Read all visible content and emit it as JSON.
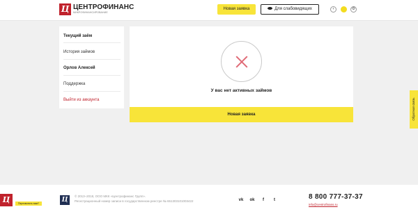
{
  "header": {
    "logo_mark": "Ц",
    "logo_name": "ЦЕНТРОФИНАНС",
    "logo_tagline": "МИКРОФИНАНСИРОВАНИЕ",
    "new_loan_label": "Новая заявка",
    "visually_impaired_label": "Для слабовидящих",
    "theme_prev_icon": "arrow-left-icon",
    "theme_sun_icon": "sun-icon",
    "settings_icon": "gear-icon"
  },
  "sidebar": {
    "items": [
      {
        "label": "Текущий заём",
        "state": "active"
      },
      {
        "label": "История займов",
        "state": "normal"
      },
      {
        "label": "Орлов Алексей",
        "state": "user"
      },
      {
        "label": "Поддержка",
        "state": "normal"
      },
      {
        "label": "Выйти из аккаунта",
        "state": "logout"
      }
    ]
  },
  "main": {
    "status_icon": "close-icon",
    "empty_message": "У вас нет активных займов",
    "new_loan_button": "Новая заявка"
  },
  "feedback_tab": {
    "label": "Обратная связь"
  },
  "footer": {
    "callback_label": "Перезвонить вам?",
    "copyright": "© 2013–2018, ООО МКК «Центрофинанс Групп».",
    "registration": "Регистрационный номер записи в государственном реестре № 651303101003422",
    "social_icons": [
      "vk-icon",
      "ok-icon",
      "facebook-icon",
      "twitter-icon"
    ],
    "social_glyphs": [
      "vk",
      "ok",
      "f",
      "t"
    ],
    "phone": "8 800 777-37-37",
    "email": "info@centrofinans.ru"
  },
  "colors": {
    "accent_yellow": "#f8e439",
    "brand_red": "#c0222c",
    "error_pink": "#e06a76",
    "background": "#f0f0f0"
  }
}
